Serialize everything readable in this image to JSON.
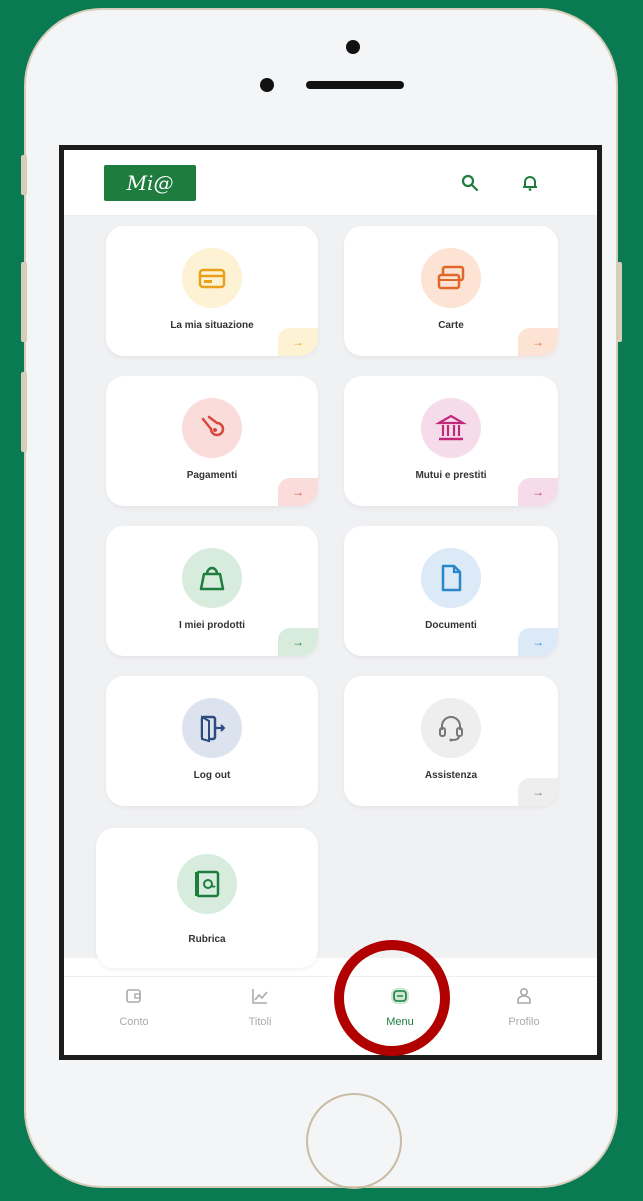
{
  "app": {
    "logo_text": "Mi@",
    "header_icons": [
      "search-icon",
      "bell-icon"
    ]
  },
  "tiles": [
    {
      "label": "La mia situazione",
      "icon": "wallet-icon",
      "color": "#e7a21a",
      "tint": "#fdf2d4",
      "arrow_tint": "#fdf2d4"
    },
    {
      "label": "Carte",
      "icon": "cards-icon",
      "color": "#e0692a",
      "tint": "#fde3d3",
      "arrow_tint": "#fde3d3"
    },
    {
      "label": "Pagamenti",
      "icon": "payment-hand-icon",
      "color": "#d9473f",
      "tint": "#fadcdb",
      "arrow_tint": "#fadcdb"
    },
    {
      "label": "Mutui e prestiti",
      "icon": "bank-icon",
      "color": "#c0297a",
      "tint": "#f6dcea",
      "arrow_tint": "#f6dcea"
    },
    {
      "label": "I miei prodotti",
      "icon": "shopping-bag-icon",
      "color": "#1e7d3e",
      "tint": "#d8ecdd",
      "arrow_tint": "#d8ecdd"
    },
    {
      "label": "Documenti",
      "icon": "document-icon",
      "color": "#2b87c9",
      "tint": "#dbeaf6",
      "arrow_tint": "#dbeaf6"
    },
    {
      "label": "Log out",
      "icon": "logout-icon",
      "color": "#2c4c7e",
      "tint": "#dde3ee",
      "arrow_tint": null
    },
    {
      "label": "Assistenza",
      "icon": "headset-icon",
      "color": "#777777",
      "tint": "#eeeeee",
      "arrow_tint": "#eeeeee"
    },
    {
      "label": "Rubrica",
      "icon": "contact-book-icon",
      "color": "#1e7d3e",
      "tint": "#d8ecdd",
      "arrow_tint": null
    }
  ],
  "arrow_glyph": "→",
  "tab_bar": [
    {
      "label": "Conto",
      "icon": "wallet-tab-icon",
      "active": false
    },
    {
      "label": "Titoli",
      "icon": "chart-tab-icon",
      "active": false
    },
    {
      "label": "Menu",
      "icon": "menu-tab-icon",
      "active": true
    },
    {
      "label": "Profilo",
      "icon": "profile-tab-icon",
      "active": false
    }
  ],
  "colors": {
    "brand_green": "#1e7d3e",
    "background_green": "#0a7a52",
    "highlight_red": "#b00000"
  }
}
